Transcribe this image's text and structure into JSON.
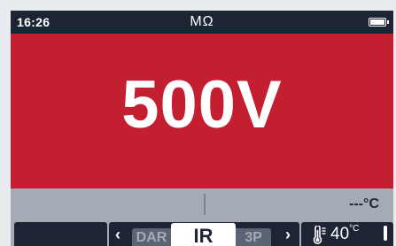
{
  "status_bar": {
    "time": "16:26",
    "unit": "MΩ",
    "icons": {
      "battery": "battery-full-icon"
    }
  },
  "main_display": {
    "value": "500V",
    "background": "#c41f30"
  },
  "info_row": {
    "temperature_reading": "---°C"
  },
  "tab_bar": {
    "modes": {
      "left": "DAR",
      "active": "IR",
      "right": "3P"
    },
    "temperature": {
      "value": "40",
      "unit": "°C",
      "icon": "thermometer-icon"
    },
    "icons": {
      "prev": "chevron-left-icon",
      "next": "chevron-right-icon"
    },
    "glyphs": {
      "prev": "‹",
      "next": "›"
    }
  },
  "colors": {
    "accent": "#c41f30",
    "dark": "#1d2535",
    "panel": "#a4abb4"
  }
}
